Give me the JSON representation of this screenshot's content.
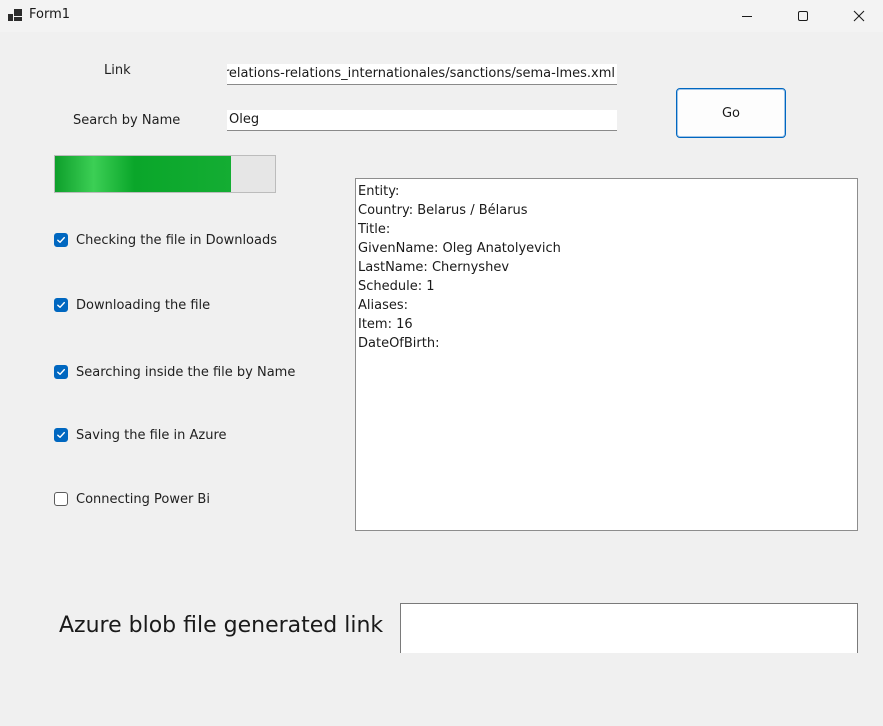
{
  "window": {
    "title": "Form1",
    "icon": "winforms-app-icon",
    "controls": [
      "minimize-icon",
      "maximize-icon",
      "close-icon"
    ]
  },
  "form": {
    "link_label": "Link",
    "link_value": "l_relations-relations_internationales/sanctions/sema-lmes.xml",
    "search_label": "Search by Name",
    "search_value": "Oleg",
    "go_label": "Go"
  },
  "progress": {
    "value": 0.8,
    "fill_color": "#10a52e"
  },
  "steps": [
    {
      "label": "Checking the file in Downloads",
      "checked": true
    },
    {
      "label": "Downloading the file",
      "checked": true
    },
    {
      "label": "Searching inside the file by Name",
      "checked": true
    },
    {
      "label": "Saving the file in Azure",
      "checked": true
    },
    {
      "label": "Connecting Power Bi",
      "checked": false
    }
  ],
  "result": {
    "lines": [
      "Entity:",
      "Country: Belarus / Bélarus",
      "Title:",
      "GivenName: Oleg Anatolyevich",
      "LastName: Chernyshev",
      "Schedule: 1",
      "Aliases:",
      "Item: 16",
      "DateOfBirth:"
    ]
  },
  "azure": {
    "label": "Azure blob file generated link",
    "value": ""
  },
  "colors": {
    "accent": "#0067c0",
    "window_bg": "#f0f0f0"
  }
}
